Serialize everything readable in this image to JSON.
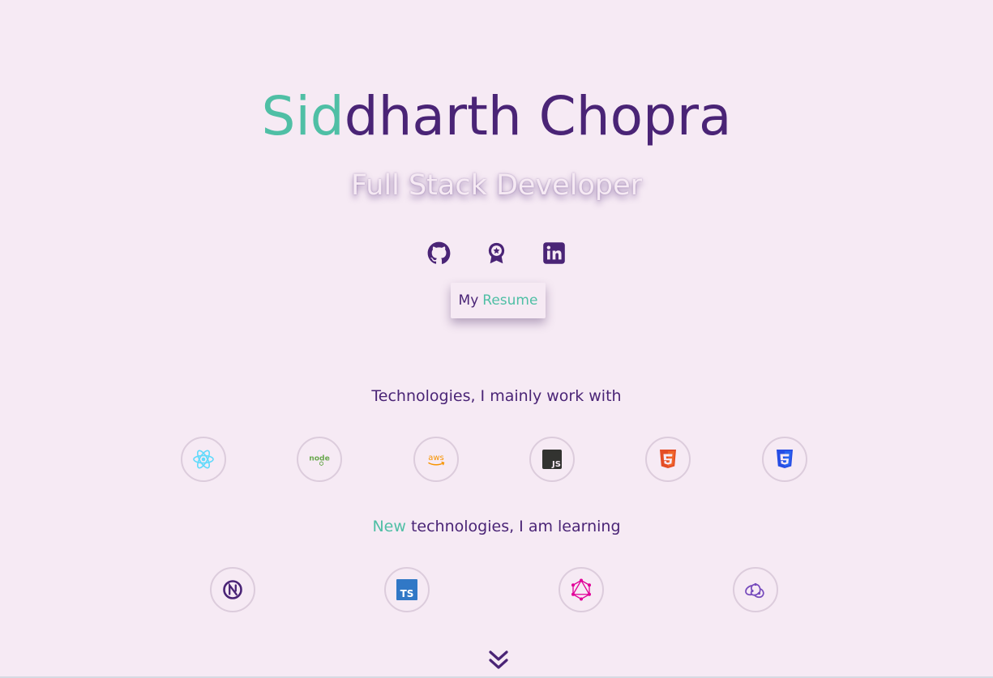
{
  "hero": {
    "name_accent": "Sid",
    "name_rest": "dharth Chopra",
    "subtitle": "Full Stack Developer"
  },
  "socials": [
    {
      "icon": "github-icon"
    },
    {
      "icon": "award-icon"
    },
    {
      "icon": "linkedin-icon"
    }
  ],
  "resume_button": {
    "prefix": "My",
    "accent": "Resume"
  },
  "main_tech": {
    "title": "Technologies, I mainly work with",
    "items": [
      {
        "icon": "react-icon"
      },
      {
        "icon": "nodejs-icon"
      },
      {
        "icon": "aws-icon"
      },
      {
        "icon": "javascript-icon"
      },
      {
        "icon": "html5-icon"
      },
      {
        "icon": "css3-icon"
      }
    ]
  },
  "new_tech": {
    "title_accent": "New",
    "title_rest": "technologies, I am learning",
    "items": [
      {
        "icon": "nextjs-icon"
      },
      {
        "icon": "typescript-icon"
      },
      {
        "icon": "graphql-icon"
      },
      {
        "icon": "redux-icon"
      }
    ]
  },
  "colors": {
    "background": "#f6eaf4",
    "primary": "#4a2476",
    "accent": "#4fbfa5"
  },
  "scroll_icon": "chevron-double-down-icon"
}
